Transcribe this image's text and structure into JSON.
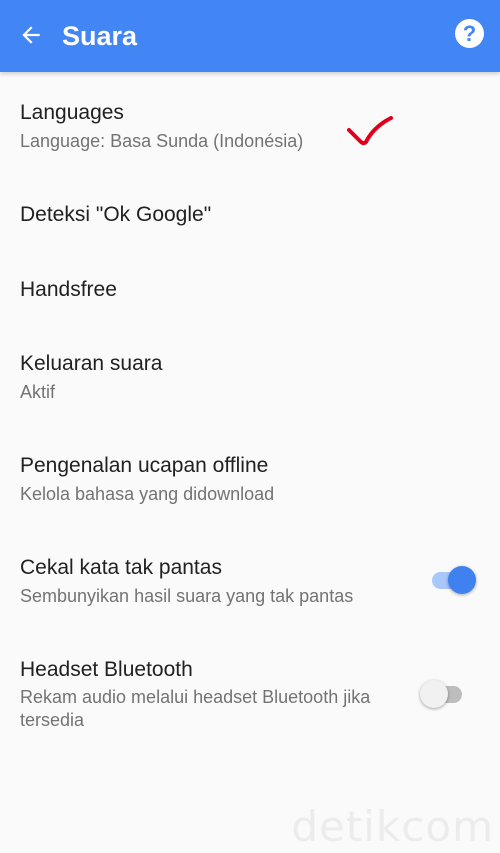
{
  "header": {
    "title": "Suara",
    "back_icon": "arrow-back-icon",
    "help_icon": "help-icon",
    "help_glyph": "?",
    "color": "#4285f4"
  },
  "settings": [
    {
      "label": "Languages",
      "sub": "Language: Basa Sunda (Indonésia)"
    },
    {
      "label": "Deteksi \"Ok Google\""
    },
    {
      "label": "Handsfree"
    },
    {
      "label": "Keluaran suara",
      "sub": "Aktif"
    },
    {
      "label": "Pengenalan ucapan offline",
      "sub": "Kelola bahasa yang didownload"
    },
    {
      "label": "Cekal kata tak pantas",
      "sub": "Sembunyikan hasil suara yang tak pantas",
      "toggle": true
    },
    {
      "label": "Headset Bluetooth",
      "sub": "Rekam audio melalui headset Bluetooth jika tersedia",
      "toggle": false
    }
  ],
  "annotation": {
    "icon": "red-checkmark-icon",
    "color": "#e0001b"
  },
  "watermark": "detikcom"
}
